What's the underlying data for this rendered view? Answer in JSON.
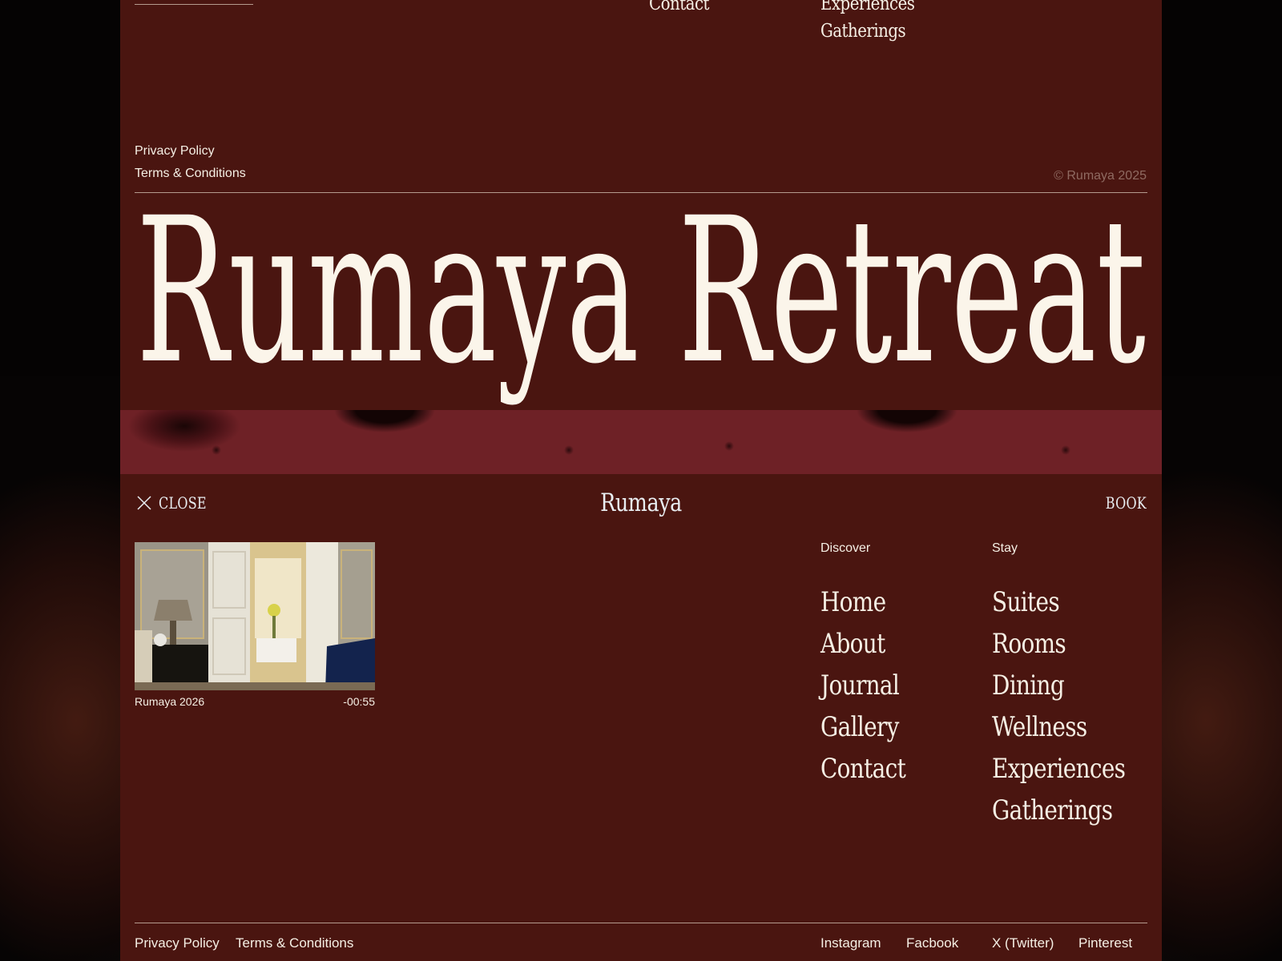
{
  "footer": {
    "nav_contact": "Contact",
    "nav_experiences": "Experiences",
    "nav_gatherings": "Gatherings",
    "privacy": "Privacy Policy",
    "terms": "Terms & Conditions",
    "copyright": "© Rumaya 2025",
    "brand_wordmark": "Rumaya Retreat"
  },
  "menu": {
    "close_label": "CLOSE",
    "logo": "Rumaya",
    "book_label": "BOOK",
    "video": {
      "caption": "Rumaya 2026",
      "time_remaining": "-00:55"
    },
    "discover": {
      "heading": "Discover",
      "items": [
        "Home",
        "About",
        "Journal",
        "Gallery",
        "Contact"
      ]
    },
    "stay": {
      "heading": "Stay",
      "items": [
        "Suites",
        "Rooms",
        "Dining",
        "Wellness",
        "Experiences",
        "Gatherings"
      ]
    },
    "bottom": {
      "privacy": "Privacy Policy",
      "terms": "Terms & Conditions",
      "social": [
        "Instagram",
        "Facbook",
        "X (Twitter)",
        "Pinterest"
      ]
    }
  },
  "colors": {
    "panel": "#4a1510",
    "text": "#f5efe4",
    "muted": "#8f6a61",
    "rule": "#b59a8e"
  },
  "icons": {
    "close": "close-icon"
  }
}
